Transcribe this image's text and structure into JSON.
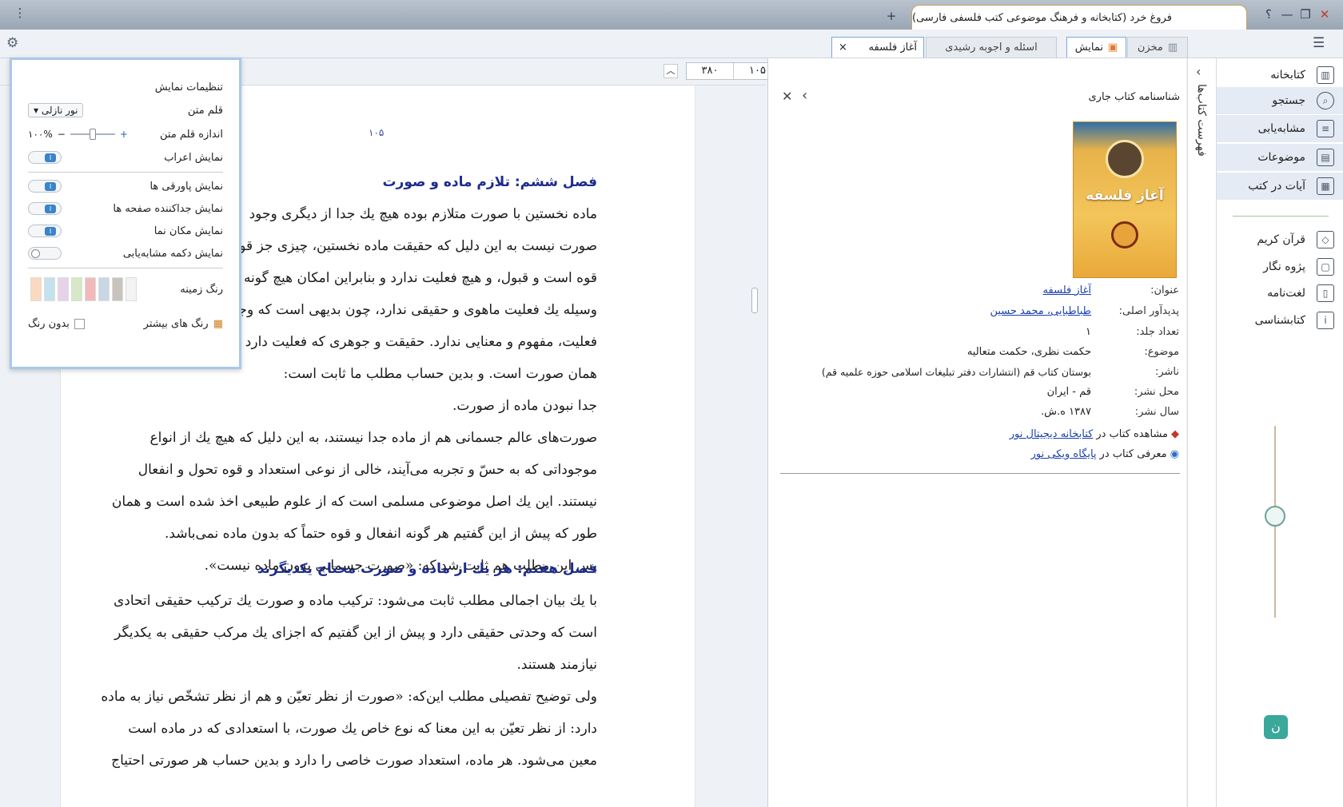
{
  "window": {
    "title": "فروغ خرد (کتابخانه و فرهنگ موضوعی کتب فلسفی فارسی)",
    "new_tab": "+",
    "help": "؟",
    "minimize": "—",
    "maximize": "❐",
    "close": "✕",
    "menu": "⋮"
  },
  "tabs": {
    "t1": "مخزن",
    "t2": "نمایش",
    "t3": "اسئله و اجوبه رشیدی",
    "t4": "آغاز فلسفه",
    "t4_close": "×"
  },
  "toolbar": {
    "page_current": "۱۰۵",
    "page_total": "۳۸۰"
  },
  "sidebar": {
    "items": [
      {
        "label": "کتابخانه",
        "icon": "library-icon"
      },
      {
        "label": "جستجو",
        "icon": "search-icon"
      },
      {
        "label": "مشابه‌یابی",
        "icon": "similar-icon"
      },
      {
        "label": "موضوعات",
        "icon": "topics-icon"
      },
      {
        "label": "آیات در کتب",
        "icon": "verses-icon"
      },
      {
        "label": "قرآن کریم",
        "icon": "quran-icon"
      },
      {
        "label": "پژوه نگار",
        "icon": "notes-icon"
      },
      {
        "label": "لغت‌نامه",
        "icon": "dictionary-icon"
      },
      {
        "label": "کتابشناسی",
        "icon": "bibliography-icon"
      }
    ]
  },
  "vstrip": {
    "label": "فهرست کتاب‌ها"
  },
  "info": {
    "title": "شناسنامه کتاب جاری",
    "cover_title": "آغاز فلسفه",
    "rows": [
      {
        "k": "عنوان:",
        "v": "آغاز فلسفه"
      },
      {
        "k": "پدیدآور اصلی:",
        "v": "طباطبایی، محمد حسین"
      },
      {
        "k": "تعداد جلد:",
        "v": "۱"
      },
      {
        "k": "موضوع:",
        "v": "حکمت نظری، حکمت متعالیه"
      },
      {
        "k": "ناشر:",
        "v": "بوستان کتاب قم (انتشارات دفتر تبلیغات اسلامی حوزه علمیه قم)"
      },
      {
        "k": "محل نشر:",
        "v": "قم - ایران"
      },
      {
        "k": "سال نشر:",
        "v": "۱۳۸۷ ه.ش."
      }
    ],
    "link1_prefix": "مشاهده کتاب در",
    "link1": "کتابخانه دیجیتال نور",
    "link2_prefix": "معرفی کتاب در",
    "link2": "پایگاه ویکی نور"
  },
  "settings": {
    "title": "تنظیمات نمایش",
    "font_label": "قلم متن",
    "font_value": "نور نازلی",
    "size_label": "اندازه قلم متن",
    "size_value": "۱۰۰%",
    "erab": "نمایش اعراب",
    "footnotes": "نمایش پاورقی ها",
    "separators": "نمایش جداکننده صفحه ها",
    "cursor": "نمایش مکان نما",
    "similar_btn": "نمایش دکمه مشابه‌یابی",
    "bg_label": "رنگ زمینه",
    "more_colors": "رنگ های بیشتر",
    "no_color": "بدون رنگ",
    "swatches": [
      "#f3f3f3",
      "#c8c4bd",
      "#c9d6e6",
      "#f1b9b9",
      "#d6e8c6",
      "#e6d3ea",
      "#c4e2ee",
      "#fbd9c0"
    ]
  },
  "page": {
    "number": "۱۰۵",
    "h1": "فصل ششم: تلازم ماده و صورت",
    "p1": [
      "ماده نخستین با صورت متلازم بوده هیچ یك جدا از دیگری وجود",
      "صورت نیست به این دلیل که حقیقت ماده نخستین، چیزی جز قوه نیـ",
      "قوه است و قبول، و هیچ فعلیت ندارد و بنابراین امکان هیچ گونه و",
      "وسیله یك فعلیت ماهوی و حقیقی ندارد، چون بدیهی است که وجود",
      "فعلیت، مفهوم و معنایی ندارد. حقیقت و جوهری که فعلیت دارد و م",
      "همان صورت است. و بدین حساب مطلب ما ثابت است:"
    ],
    "h1b": "جدا نبودن ماده از صورت.",
    "p2": [
      "صورت‌های عالم جسمانی هم از ماده جدا نیستند، به این دلیل که هیچ یك از انواع",
      "موجوداتی که به حسّ و تجربه می‌آیند، خالی از نوعی استعداد و قوه تحول و انفعال",
      "نیستند. این یك اصل موضوعی مسلمی است که از علوم طبیعی اخذ شده است و همان",
      "طور که پیش از این گفتیم هر گونه انفعال و قوه حتماً که بدون ماده نمی‌باشد."
    ],
    "p3": "پس این مطلب هم ثابت شد که: «صورت جسمانی بدون ماده نیست».",
    "h2": "فصل هفتم: هر یك از ماده و صورت محتاج یکدیگرند",
    "p4": [
      "با یك بیان اجمالی مطلب ثابت می‌شود: ترکیب ماده و صورت یك ترکیب حقیقی اتحادی",
      "است که وحدتی حقیقی دارد و پیش از این گفتیم که اجزای یك مرکب حقیقی به یکدیگر",
      "نیازمند هستند."
    ],
    "p5": [
      "ولی توضیح تفصیلی مطلب این‌که: «صورت از نظر تعیّن و هم از نظر تشخّص نیاز به ماده",
      "دارد: از نظر تعیّن به این معنا که نوع خاص یك صورت، با استعدادی که در ماده است",
      "معین می‌شود. هر ماده، استعداد صورت خاصی را دارد و بدین حساب هر صورتی احتیاج"
    ]
  }
}
